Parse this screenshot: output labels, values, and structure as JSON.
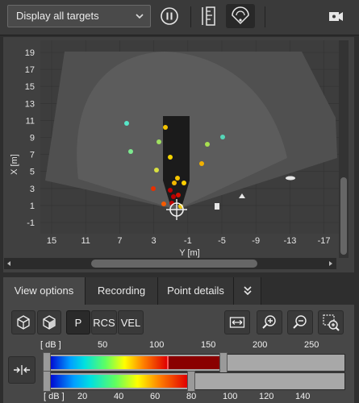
{
  "toolbar": {
    "target_filter_value": "Display all targets",
    "icons": [
      "chevron-down-icon",
      "pause-icon",
      "ruler-icon",
      "radar-fov-icon",
      "camera-icon"
    ]
  },
  "plot": {
    "x_axis_label": "Y [m]",
    "y_axis_label": "X [m]",
    "x_ticks": [
      "15",
      "11",
      "7",
      "3",
      "-1",
      "-5",
      "-9",
      "-13",
      "-17"
    ],
    "y_ticks": [
      "19",
      "17",
      "15",
      "13",
      "11",
      "9",
      "7",
      "5",
      "3",
      "1",
      "-1"
    ],
    "x_range": [
      15,
      -17
    ],
    "y_range": [
      -1,
      19
    ],
    "grid": true
  },
  "tabs": [
    {
      "label": "View options",
      "active": true
    },
    {
      "label": "Recording",
      "active": false
    },
    {
      "label": "Point details",
      "active": false
    }
  ],
  "view_options": {
    "mode_buttons": [
      {
        "label": "P",
        "selected": true
      },
      {
        "label": "RCS",
        "selected": false
      },
      {
        "label": "VEL",
        "selected": false
      }
    ],
    "icons": [
      "3d-view-icon",
      "3d-view-alt-icon",
      "fit-width-icon",
      "zoom-in-icon",
      "zoom-out-icon",
      "zoom-region-icon",
      "link-sliders-icon"
    ]
  },
  "power_scale": {
    "unit_label_top": "[ dB ]",
    "ticks_top": [
      "50",
      "100",
      "150",
      "200",
      "250"
    ],
    "unit_label_bottom": "[ dB ]",
    "ticks_bottom": [
      "20",
      "40",
      "60",
      "80",
      "100",
      "120",
      "140"
    ],
    "upper_threshold_fraction": 0.4,
    "upper_color_end_fraction": 0.58,
    "lower_threshold_fraction": 0.47
  },
  "colors": {
    "dark_bg": "#2e2e2e",
    "panel": "#404040",
    "fov_outer": "#4e4e4e",
    "fov_inner": "#5b5b5b",
    "vehicle": "#1a1a1a"
  }
}
